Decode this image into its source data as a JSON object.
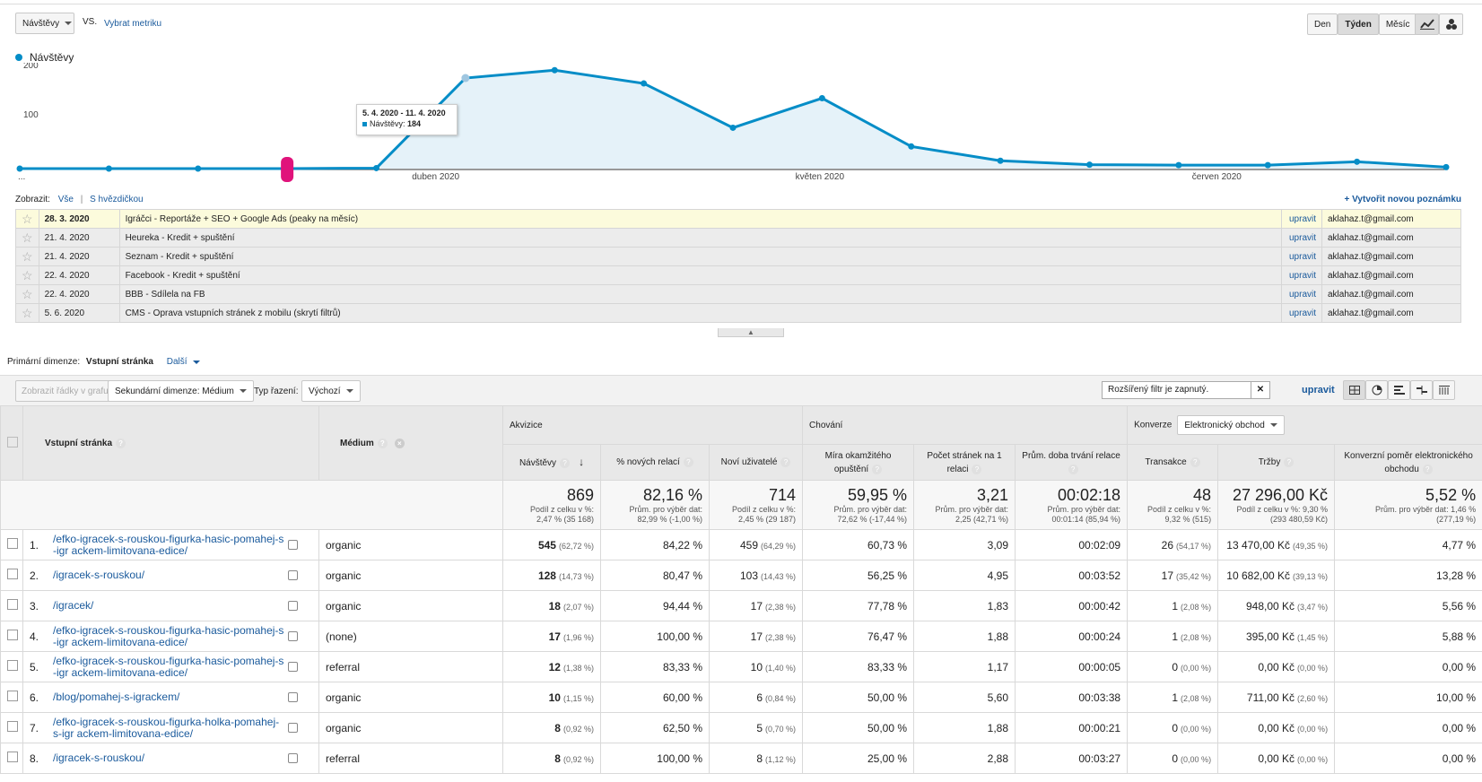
{
  "toolbar": {
    "metric": "Návštěvy",
    "vs": "VS.",
    "select_metric": "Vybrat metriku",
    "periods": [
      "Den",
      "Týden",
      "Měsíc"
    ],
    "active_period": "Týden"
  },
  "legend": {
    "label": "Návštěvy",
    "color": "#058dc7"
  },
  "chart_data": {
    "type": "area",
    "series": [
      {
        "name": "Návštěvy",
        "values": [
          0,
          0,
          0,
          0,
          1,
          184,
          200,
          173,
          83,
          143,
          45,
          16,
          8,
          7,
          7,
          14,
          3
        ]
      }
    ],
    "y_ticks": [
      "200",
      "100"
    ],
    "ylim": [
      0,
      215
    ],
    "x_labels": [
      "duben 2020",
      "květen 2020",
      "červen 2020"
    ],
    "axis_start_label": "...",
    "color": "#058dc7",
    "tooltip": {
      "title": "5. 4. 2020 - 11. 4. 2020",
      "label": "Návštěvy:",
      "value": "184"
    }
  },
  "annotations": {
    "show_label": "Zobrazit:",
    "show_all": "Vše",
    "separator": "|",
    "show_starred": "S hvězdičkou",
    "create_new": "+ Vytvořit novou poznámku",
    "rows": [
      {
        "date": "28. 3. 2020",
        "text": "Igráčci - Reportáže + SEO + Google Ads (peaky na měsíc)",
        "action": "upravit",
        "user": "aklahaz.t@gmail.com",
        "highlight": true
      },
      {
        "date": "21. 4. 2020",
        "text": "Heureka - Kredit + spuštění",
        "action": "upravit",
        "user": "aklahaz.t@gmail.com",
        "highlight": false
      },
      {
        "date": "21. 4. 2020",
        "text": "Seznam - Kredit + spuštění",
        "action": "upravit",
        "user": "aklahaz.t@gmail.com",
        "highlight": false
      },
      {
        "date": "22. 4. 2020",
        "text": "Facebook - Kredit + spuštění",
        "action": "upravit",
        "user": "aklahaz.t@gmail.com",
        "highlight": false
      },
      {
        "date": "22. 4. 2020",
        "text": "BBB - Sdílela na FB",
        "action": "upravit",
        "user": "aklahaz.t@gmail.com",
        "highlight": false
      },
      {
        "date": "5. 6. 2020",
        "text": "CMS - Oprava vstupních stránek z mobilu (skrytí filtrů)",
        "action": "upravit",
        "user": "aklahaz.t@gmail.com",
        "highlight": false
      }
    ]
  },
  "dimension": {
    "primary_label": "Primární dimenze:",
    "primary_value": "Vstupní stránka",
    "other": "Další",
    "plot_rows": "Zobrazit řádky v grafu",
    "secondary": "Sekundární dimenze: Médium",
    "sort_label": "Typ řazení:",
    "sort_value": "Výchozí",
    "filter_text": "Rozšířený filtr je zapnutý.",
    "filter_edit": "upravit"
  },
  "table": {
    "groups": {
      "acquisition": "Akvizice",
      "behavior": "Chování",
      "conversions": "Konverze",
      "conversion_select": "Elektronický obchod"
    },
    "headers": {
      "landing_page": "Vstupní stránka",
      "medium": "Médium",
      "sessions": "Návštěvy",
      "new_sessions": "% nových relací",
      "new_users": "Noví uživatelé",
      "bounce": "Míra okamžitého opuštění",
      "pages": "Počet stránek na 1 relaci",
      "duration": "Prům. doba trvání relace",
      "transactions": "Transakce",
      "revenue": "Tržby",
      "conv_rate": "Konverzní poměr elektronického obchodu"
    },
    "totals": {
      "sessions": {
        "v": "869",
        "s1": "Podíl z celku v %:",
        "s2": "2,47 % (35 168)"
      },
      "new_sessions": {
        "v": "82,16 %",
        "s1": "Prům. pro výběr dat:",
        "s2": "82,99 % (-1,00 %)"
      },
      "new_users": {
        "v": "714",
        "s1": "Podíl z celku v %:",
        "s2": "2,45 % (29 187)"
      },
      "bounce": {
        "v": "59,95 %",
        "s1": "Prům. pro výběr dat:",
        "s2": "72,62 % (-17,44 %)"
      },
      "pages": {
        "v": "3,21",
        "s1": "Prům. pro výběr dat:",
        "s2": "2,25 (42,71 %)"
      },
      "duration": {
        "v": "00:02:18",
        "s1": "Prům. pro výběr dat:",
        "s2": "00:01:14 (85,94 %)"
      },
      "transactions": {
        "v": "48",
        "s1": "Podíl z celku v %:",
        "s2": "9,32 % (515)"
      },
      "revenue": {
        "v": "27 296,00 Kč",
        "s1": "Podíl z celku v %: 9,30 %",
        "s2": "(293 480,59 Kč)"
      },
      "conv_rate": {
        "v": "5,52 %",
        "s1": "Prům. pro výběr dat: 1,46 %",
        "s2": "(277,19 %)"
      }
    },
    "rows": [
      {
        "n": "1.",
        "page": "/efko-igracek-s-rouskou-figurka-hasic-pomahej-s-igr ackem-limitovana-edice/",
        "medium": "organic",
        "sessions": "545",
        "sessions_pct": "(62,72 %)",
        "new_sessions": "84,22 %",
        "new_users": "459",
        "new_users_pct": "(64,29 %)",
        "bounce": "60,73 %",
        "pages": "3,09",
        "duration": "00:02:09",
        "transactions": "26",
        "transactions_pct": "(54,17 %)",
        "revenue": "13 470,00 Kč",
        "revenue_pct": "(49,35 %)",
        "conv": "4,77 %"
      },
      {
        "n": "2.",
        "page": "/igracek-s-rouskou/",
        "medium": "organic",
        "sessions": "128",
        "sessions_pct": "(14,73 %)",
        "new_sessions": "80,47 %",
        "new_users": "103",
        "new_users_pct": "(14,43 %)",
        "bounce": "56,25 %",
        "pages": "4,95",
        "duration": "00:03:52",
        "transactions": "17",
        "transactions_pct": "(35,42 %)",
        "revenue": "10 682,00 Kč",
        "revenue_pct": "(39,13 %)",
        "conv": "13,28 %"
      },
      {
        "n": "3.",
        "page": "/igracek/",
        "medium": "organic",
        "sessions": "18",
        "sessions_pct": "(2,07 %)",
        "new_sessions": "94,44 %",
        "new_users": "17",
        "new_users_pct": "(2,38 %)",
        "bounce": "77,78 %",
        "pages": "1,83",
        "duration": "00:00:42",
        "transactions": "1",
        "transactions_pct": "(2,08 %)",
        "revenue": "948,00 Kč",
        "revenue_pct": "(3,47 %)",
        "conv": "5,56 %"
      },
      {
        "n": "4.",
        "page": "/efko-igracek-s-rouskou-figurka-hasic-pomahej-s-igr ackem-limitovana-edice/",
        "medium": "(none)",
        "sessions": "17",
        "sessions_pct": "(1,96 %)",
        "new_sessions": "100,00 %",
        "new_users": "17",
        "new_users_pct": "(2,38 %)",
        "bounce": "76,47 %",
        "pages": "1,88",
        "duration": "00:00:24",
        "transactions": "1",
        "transactions_pct": "(2,08 %)",
        "revenue": "395,00 Kč",
        "revenue_pct": "(1,45 %)",
        "conv": "5,88 %"
      },
      {
        "n": "5.",
        "page": "/efko-igracek-s-rouskou-figurka-hasic-pomahej-s-igr ackem-limitovana-edice/",
        "medium": "referral",
        "sessions": "12",
        "sessions_pct": "(1,38 %)",
        "new_sessions": "83,33 %",
        "new_users": "10",
        "new_users_pct": "(1,40 %)",
        "bounce": "83,33 %",
        "pages": "1,17",
        "duration": "00:00:05",
        "transactions": "0",
        "transactions_pct": "(0,00 %)",
        "revenue": "0,00 Kč",
        "revenue_pct": "(0,00 %)",
        "conv": "0,00 %"
      },
      {
        "n": "6.",
        "page": "/blog/pomahej-s-igrackem/",
        "medium": "organic",
        "sessions": "10",
        "sessions_pct": "(1,15 %)",
        "new_sessions": "60,00 %",
        "new_users": "6",
        "new_users_pct": "(0,84 %)",
        "bounce": "50,00 %",
        "pages": "5,60",
        "duration": "00:03:38",
        "transactions": "1",
        "transactions_pct": "(2,08 %)",
        "revenue": "711,00 Kč",
        "revenue_pct": "(2,60 %)",
        "conv": "10,00 %"
      },
      {
        "n": "7.",
        "page": "/efko-igracek-s-rouskou-figurka-holka-pomahej-s-igr ackem-limitovana-edice/",
        "medium": "organic",
        "sessions": "8",
        "sessions_pct": "(0,92 %)",
        "new_sessions": "62,50 %",
        "new_users": "5",
        "new_users_pct": "(0,70 %)",
        "bounce": "50,00 %",
        "pages": "1,88",
        "duration": "00:00:21",
        "transactions": "0",
        "transactions_pct": "(0,00 %)",
        "revenue": "0,00 Kč",
        "revenue_pct": "(0,00 %)",
        "conv": "0,00 %"
      },
      {
        "n": "8.",
        "page": "/igracek-s-rouskou/",
        "medium": "referral",
        "sessions": "8",
        "sessions_pct": "(0,92 %)",
        "new_sessions": "100,00 %",
        "new_users": "8",
        "new_users_pct": "(1,12 %)",
        "bounce": "25,00 %",
        "pages": "2,88",
        "duration": "00:03:27",
        "transactions": "0",
        "transactions_pct": "(0,00 %)",
        "revenue": "0,00 Kč",
        "revenue_pct": "(0,00 %)",
        "conv": "0,00 %"
      }
    ]
  }
}
